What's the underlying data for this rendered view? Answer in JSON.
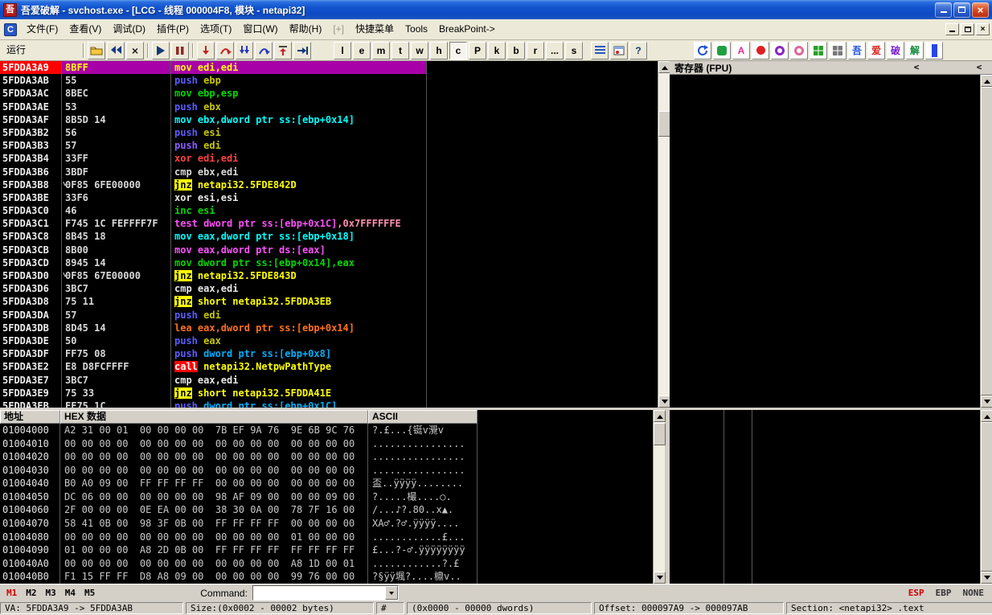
{
  "titlebar": {
    "icon_text": "吾",
    "title": "吾爱破解 - svchost.exe - [LCG - 线程 000004F8, 模块 - netapi32]"
  },
  "menubar": {
    "cpu_icon_text": "C",
    "items": [
      {
        "label": "文件(F)",
        "disabled": false
      },
      {
        "label": "查看(V)",
        "disabled": false
      },
      {
        "label": "调试(D)",
        "disabled": false
      },
      {
        "label": "插件(P)",
        "disabled": false
      },
      {
        "label": "选项(T)",
        "disabled": false
      },
      {
        "label": "窗口(W)",
        "disabled": false
      },
      {
        "label": "帮助(H)",
        "disabled": false
      },
      {
        "label": "[+]",
        "disabled": true
      },
      {
        "label": "快捷菜单",
        "disabled": false
      },
      {
        "label": "Tools",
        "disabled": false
      },
      {
        "label": "BreakPoint->",
        "disabled": false
      }
    ]
  },
  "toolbar": {
    "state_label": "运行",
    "letter_buttons": [
      "l",
      "e",
      "m",
      "t",
      "w",
      "h",
      "c",
      "P",
      "k",
      "b",
      "r",
      "...",
      "s"
    ],
    "pressed_letter": "c",
    "help_label": "?",
    "plugin_a_label": "A",
    "pojie_buttons": [
      {
        "label": "吾",
        "color": "#1d50d8"
      },
      {
        "label": "爱",
        "color": "#d8231d"
      },
      {
        "label": "破",
        "color": "#7a1dd8"
      },
      {
        "label": "解",
        "color": "#128a3c"
      }
    ]
  },
  "disasm": {
    "rows": [
      {
        "addr": "5FDDA3A9",
        "bytes": "8BFF",
        "sel": true,
        "ins": [
          {
            "t": "mov edi,edi",
            "c": "#ffff00"
          }
        ]
      },
      {
        "addr": "5FDDA3AB",
        "bytes": "55",
        "ins": [
          {
            "t": "push",
            "c": "#5c5cff"
          },
          {
            "t": " ebp",
            "c": "#c8c800"
          }
        ]
      },
      {
        "addr": "5FDDA3AC",
        "bytes": "8BEC",
        "ins": [
          {
            "t": "mov ebp,esp",
            "c": "#00d800"
          }
        ]
      },
      {
        "addr": "5FDDA3AE",
        "bytes": "53",
        "ins": [
          {
            "t": "push",
            "c": "#5c5cff"
          },
          {
            "t": " ebx",
            "c": "#c8c800"
          }
        ]
      },
      {
        "addr": "5FDDA3AF",
        "bytes": "8B5D 14",
        "ins": [
          {
            "t": "mov ebx,dword ptr ss:[ebp+0x14]",
            "c": "#00ffff"
          }
        ]
      },
      {
        "addr": "5FDDA3B2",
        "bytes": "56",
        "ins": [
          {
            "t": "push",
            "c": "#5c5cff"
          },
          {
            "t": " esi",
            "c": "#c8c800"
          }
        ]
      },
      {
        "addr": "5FDDA3B3",
        "bytes": "57",
        "ins": [
          {
            "t": "push",
            "c": "#8c5cff"
          },
          {
            "t": " edi",
            "c": "#c8c800"
          }
        ]
      },
      {
        "addr": "5FDDA3B4",
        "bytes": "33FF",
        "ins": [
          {
            "t": "xor edi,edi",
            "c": "#ff4040"
          }
        ]
      },
      {
        "addr": "5FDDA3B6",
        "bytes": "3BDF",
        "ins": [
          {
            "t": "cmp ebx,edi",
            "c": "#d8d8d8"
          }
        ]
      },
      {
        "addr": "5FDDA3B8",
        "mark": "˅",
        "bytes": "0F85 6FE00000",
        "ins": [
          {
            "t": "jnz",
            "c": "#000000",
            "bg": "#ffff00"
          },
          {
            "t": " netapi32.5FDE842D",
            "c": "#ffff00"
          }
        ]
      },
      {
        "addr": "5FDDA3BE",
        "bytes": "33F6",
        "ins": [
          {
            "t": "xor esi,esi",
            "c": "#e8e8e8"
          }
        ]
      },
      {
        "addr": "5FDDA3C0",
        "bytes": "46",
        "ins": [
          {
            "t": "inc esi",
            "c": "#00d800"
          }
        ]
      },
      {
        "addr": "5FDDA3C1",
        "bytes": "F745 1C FEFFFF7F",
        "ins": [
          {
            "t": "test dword ptr ss:[ebp+0x1C]",
            "c": "#ff50ff"
          },
          {
            "t": ",0x7FFFFFFE",
            "c": "#ff8fb0"
          }
        ]
      },
      {
        "addr": "5FDDA3C8",
        "bytes": "8B45 18",
        "ins": [
          {
            "t": "mov eax,dword ptr ss:[ebp+0x18]",
            "c": "#00ffff"
          }
        ]
      },
      {
        "addr": "5FDDA3CB",
        "bytes": "8B00",
        "ins": [
          {
            "t": "mov eax,dword ptr ds:[eax]",
            "c": "#ff50ff"
          }
        ]
      },
      {
        "addr": "5FDDA3CD",
        "bytes": "8945 14",
        "ins": [
          {
            "t": "mov dword ptr ss:[ebp+0x14],eax",
            "c": "#00d800"
          }
        ]
      },
      {
        "addr": "5FDDA3D0",
        "mark": "˅",
        "bytes": "0F85 67E00000",
        "ins": [
          {
            "t": "jnz",
            "c": "#000000",
            "bg": "#ffff00"
          },
          {
            "t": " netapi32.5FDE843D",
            "c": "#ffff00"
          }
        ]
      },
      {
        "addr": "5FDDA3D6",
        "bytes": "3BC7",
        "ins": [
          {
            "t": "cmp eax,edi",
            "c": "#e8e8e8"
          }
        ]
      },
      {
        "addr": "5FDDA3D8",
        "bytes": "75 11",
        "ins": [
          {
            "t": "jnz",
            "c": "#000000",
            "bg": "#ffff00"
          },
          {
            "t": " short netapi32.5FDDA3EB",
            "c": "#ffff00"
          }
        ]
      },
      {
        "addr": "5FDDA3DA",
        "bytes": "57",
        "ins": [
          {
            "t": "push",
            "c": "#5c5cff"
          },
          {
            "t": " edi",
            "c": "#c8c800"
          }
        ]
      },
      {
        "addr": "5FDDA3DB",
        "bytes": "8D45 14",
        "ins": [
          {
            "t": "lea eax,dword ptr ss:[ebp+0x14]",
            "c": "#ff7020"
          }
        ]
      },
      {
        "addr": "5FDDA3DE",
        "bytes": "50",
        "ins": [
          {
            "t": "push",
            "c": "#5c5cff"
          },
          {
            "t": " eax",
            "c": "#c8c800"
          }
        ]
      },
      {
        "addr": "5FDDA3DF",
        "bytes": "FF75 08",
        "ins": [
          {
            "t": "push",
            "c": "#5c5cff"
          },
          {
            "t": " dword ptr ss:[ebp+0x8]",
            "c": "#00b0ff"
          }
        ]
      },
      {
        "addr": "5FDDA3E2",
        "bytes": "E8 D8FCFFFF",
        "ins": [
          {
            "t": "call",
            "c": "#ffffff",
            "bg": "#ff0000"
          },
          {
            "t": " netapi32.NetpwPathType",
            "c": "#ffff00"
          }
        ]
      },
      {
        "addr": "5FDDA3E7",
        "bytes": "3BC7",
        "ins": [
          {
            "t": "cmp eax,edi",
            "c": "#e8e8e8"
          }
        ]
      },
      {
        "addr": "5FDDA3E9",
        "bytes": "75 33",
        "ins": [
          {
            "t": "jnz",
            "c": "#000000",
            "bg": "#ffff00"
          },
          {
            "t": " short netapi32.5FDDA41E",
            "c": "#ffff00"
          }
        ]
      },
      {
        "addr": "5FDDA3EB",
        "bytes": "FF75 1C",
        "ins": [
          {
            "t": "push",
            "c": "#5c5cff"
          },
          {
            "t": " dword ptr ss:[ebp+0x1C]",
            "c": "#00b0ff"
          }
        ]
      }
    ]
  },
  "registers": {
    "title": "寄存器 (FPU)",
    "arrow_left": "<",
    "arrow_right": "<"
  },
  "dump": {
    "col_addr": "地址",
    "col_hex": "HEX 数据",
    "col_ascii": "ASCII",
    "rows": [
      {
        "addr": "01004000",
        "hex": "A2 31 00 01  00 00 00 00  7B EF 9A 76  9E 6B 9C 76",
        "ascii": "?.£...{铤v灚v"
      },
      {
        "addr": "01004010",
        "hex": "00 00 00 00  00 00 00 00  00 00 00 00  00 00 00 00",
        "ascii": "................"
      },
      {
        "addr": "01004020",
        "hex": "00 00 00 00  00 00 00 00  00 00 00 00  00 00 00 00",
        "ascii": "................"
      },
      {
        "addr": "01004030",
        "hex": "00 00 00 00  00 00 00 00  00 00 00 00  00 00 00 00",
        "ascii": "................"
      },
      {
        "addr": "01004040",
        "hex": "B0 A0 09 00  FF FF FF FF  00 00 00 00  00 00 00 00",
        "ascii": "盃..ÿÿÿÿ........"
      },
      {
        "addr": "01004050",
        "hex": "DC 06 00 00  00 00 00 00  98 AF 09 00  00 00 09 00",
        "ascii": "?.....樶....○."
      },
      {
        "addr": "01004060",
        "hex": "2F 00 00 00  0E EA 00 00  38 30 0A 00  78 7F 16 00",
        "ascii": "/...♪?.80..x▲."
      },
      {
        "addr": "01004070",
        "hex": "58 41 0B 00  98 3F 0B 00  FF FF FF FF  00 00 00 00",
        "ascii": "XA♂.?♂.ÿÿÿÿ...."
      },
      {
        "addr": "01004080",
        "hex": "00 00 00 00  00 00 00 00  00 00 00 00  01 00 00 00",
        "ascii": "............£..."
      },
      {
        "addr": "01004090",
        "hex": "01 00 00 00  A8 2D 0B 00  FF FF FF FF  FF FF FF FF",
        "ascii": "£...?-♂.ÿÿÿÿÿÿÿÿ"
      },
      {
        "addr": "010040A0",
        "hex": "00 00 00 00  00 00 00 00  00 00 00 00  A8 1D 00 01",
        "ascii": "............?.£"
      },
      {
        "addr": "010040B0",
        "hex": "F1 15 FF FF  D8 A8 09 00  00 00 00 00  99 76 00 00",
        "ascii": "?§ÿÿ堸?....檙v.."
      }
    ]
  },
  "commandbar": {
    "tabs": [
      {
        "label": "M1",
        "active": true
      },
      {
        "label": "M2",
        "active": false
      },
      {
        "label": "M3",
        "active": false
      },
      {
        "label": "M4",
        "active": false
      },
      {
        "label": "M5",
        "active": false
      }
    ],
    "command_label": "Command:",
    "command_value": "",
    "flags": [
      {
        "label": "ESP",
        "color": "#cc0000"
      },
      {
        "label": "EBP",
        "color": "#333333"
      },
      {
        "label": "NONE",
        "color": "#333333"
      }
    ]
  },
  "statusbar": {
    "segments": [
      "VA: 5FDDA3A9 -> 5FDDA3AB",
      "Size:(0x0002 - 00002 bytes)",
      "#",
      "(0x0000 - 00000 dwords)",
      "Offset: 000097A9 -> 000097AB",
      "Section: <netapi32> .text"
    ]
  }
}
